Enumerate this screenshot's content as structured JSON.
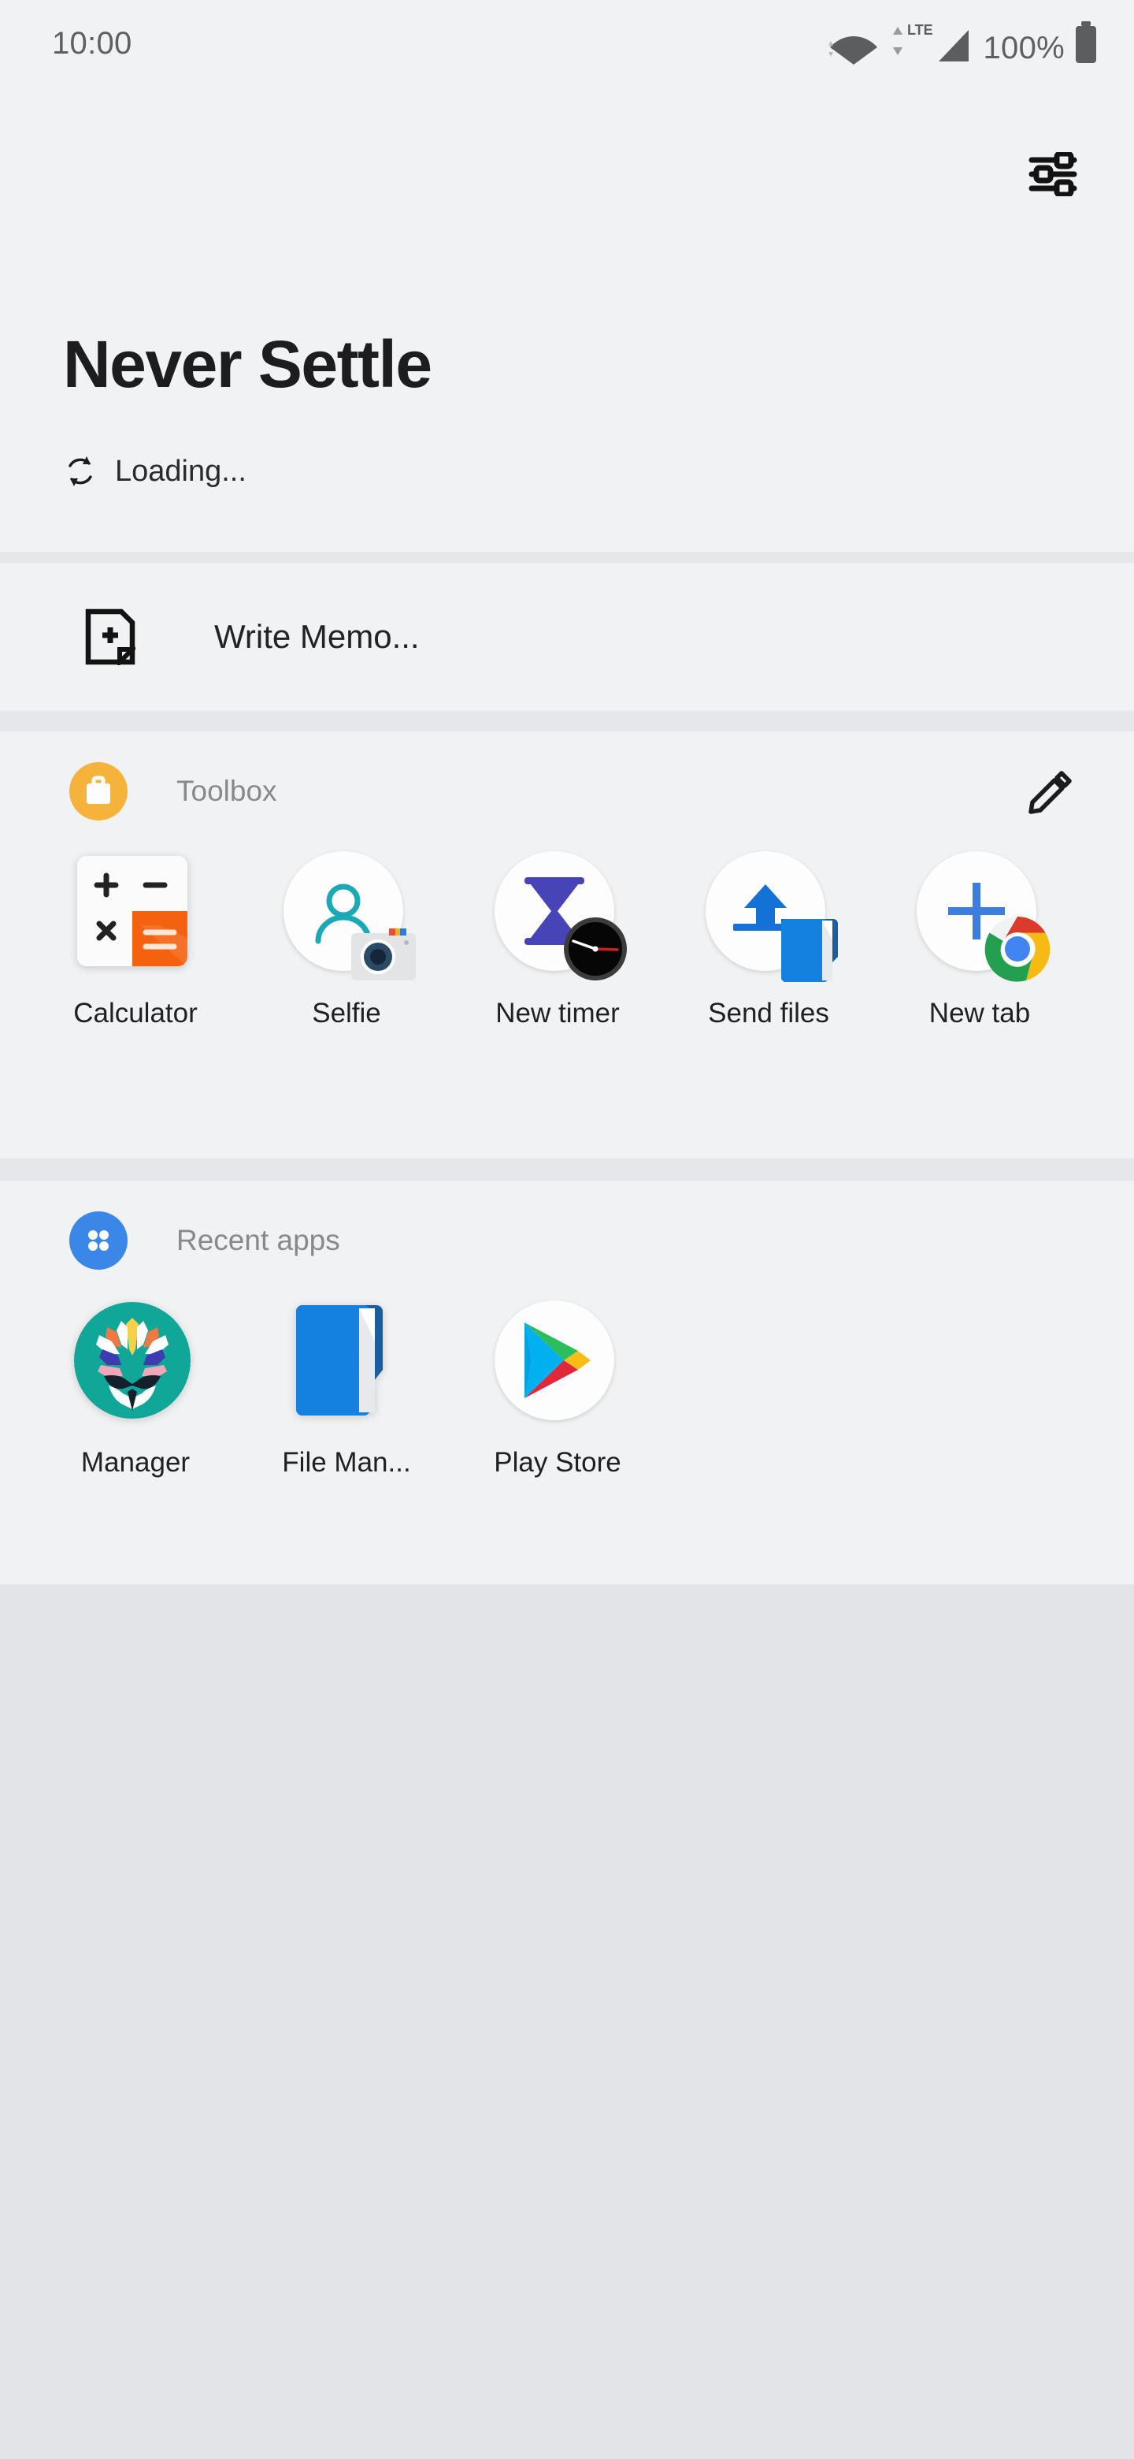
{
  "status_bar": {
    "clock": "10:00",
    "battery_percent": "100%",
    "network_label": "LTE",
    "icons": [
      "wifi-icon",
      "cellular-signal-icon",
      "battery-icon"
    ]
  },
  "header": {
    "title": "Never Settle",
    "loading_text": "Loading...",
    "settings_icon": "tune-sliders-icon"
  },
  "memo": {
    "label": "Write Memo...",
    "icon": "note-add-icon"
  },
  "toolbox": {
    "title": "Toolbox",
    "badge_icon": "briefcase-icon",
    "badge_color": "#f5b33c",
    "action_icon": "edit-pencil-icon",
    "items": [
      {
        "label": "Calculator",
        "icon": "calculator-icon",
        "badge": "none"
      },
      {
        "label": "Selfie",
        "icon": "person-icon",
        "badge": "camera-icon"
      },
      {
        "label": "New timer",
        "icon": "hourglass-icon",
        "badge": "clock-icon"
      },
      {
        "label": "Send files",
        "icon": "upload-arrow-icon",
        "badge": "folder-icon"
      },
      {
        "label": "New tab",
        "icon": "plus-icon",
        "badge": "chrome-icon"
      }
    ]
  },
  "recent_apps": {
    "title": "Recent apps",
    "badge_icon": "app-grid-icon",
    "badge_color": "#3a87e8",
    "items": [
      {
        "label": "Manager",
        "icon": "magisk-icon"
      },
      {
        "label": "File Man...",
        "icon": "folder-icon"
      },
      {
        "label": "Play Store",
        "icon": "play-store-icon"
      }
    ]
  },
  "colors": {
    "panel_bg": "#f1f2f3",
    "page_bg": "#e3e4e7",
    "divider": "#e6e7ea",
    "text_primary": "#1d1d1f",
    "text_muted": "#88898c",
    "accent_orange": "#f5b33c",
    "accent_blue": "#3a87e8"
  }
}
